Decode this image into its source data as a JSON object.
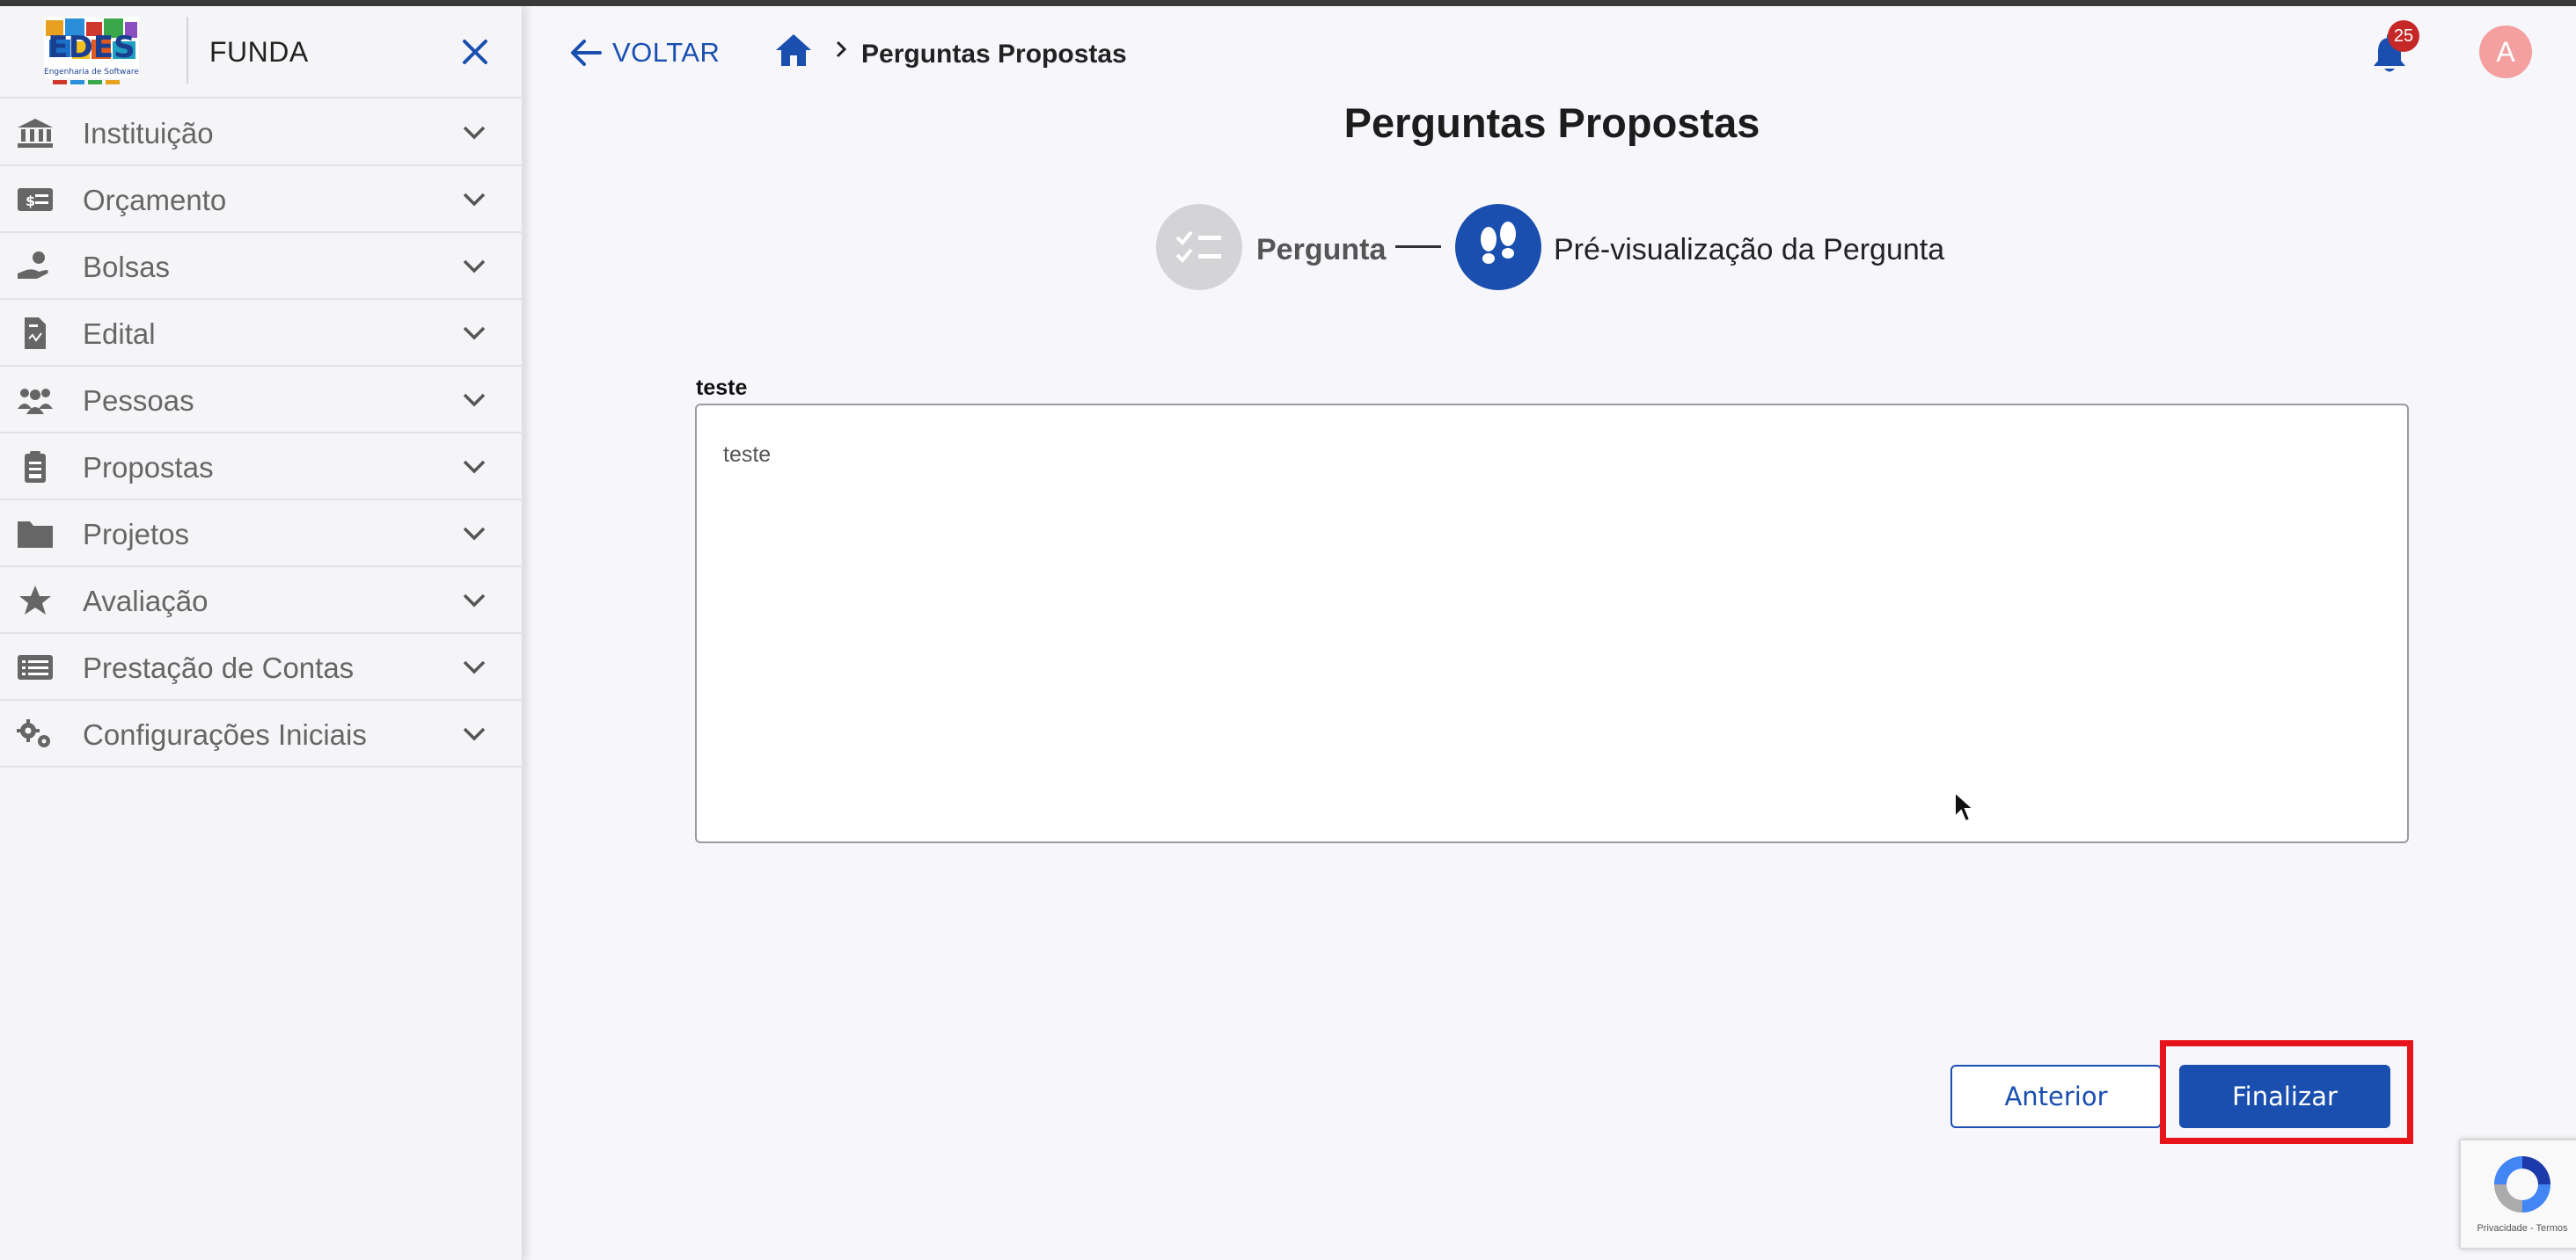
{
  "sidebar": {
    "logo_alt": "EDES Engenharia de Software",
    "title": "FUNDA",
    "items": [
      {
        "label": "Instituição",
        "icon": "bank-icon"
      },
      {
        "label": "Orçamento",
        "icon": "money-card-icon"
      },
      {
        "label": "Bolsas",
        "icon": "hand-coin-icon"
      },
      {
        "label": "Edital",
        "icon": "document-icon"
      },
      {
        "label": "Pessoas",
        "icon": "people-icon"
      },
      {
        "label": "Propostas",
        "icon": "clipboard-icon"
      },
      {
        "label": "Projetos",
        "icon": "folder-icon"
      },
      {
        "label": "Avaliação",
        "icon": "star-icon"
      },
      {
        "label": "Prestação de Contas",
        "icon": "list-icon"
      },
      {
        "label": "Configurações Iniciais",
        "icon": "gears-icon"
      }
    ]
  },
  "header": {
    "back_label": "VOLTAR",
    "breadcrumb_current": "Perguntas Propostas",
    "notification_count": "25",
    "avatar_initial": "A"
  },
  "main": {
    "title": "Perguntas Propostas",
    "steps": [
      {
        "label": "Pergunta",
        "state": "completed"
      },
      {
        "label": "Pré-visualização da Pergunta",
        "state": "active"
      }
    ],
    "field": {
      "label": "teste",
      "value": "teste"
    },
    "buttons": {
      "previous": "Anterior",
      "finish": "Finalizar"
    }
  },
  "recaptcha": {
    "text": "Privacidade - Termos"
  },
  "colors": {
    "primary": "#1a4fb0",
    "highlight": "#e8141b",
    "badge": "#c62828",
    "avatar": "#f4a0a0",
    "step_inactive": "#d4d4d6"
  }
}
